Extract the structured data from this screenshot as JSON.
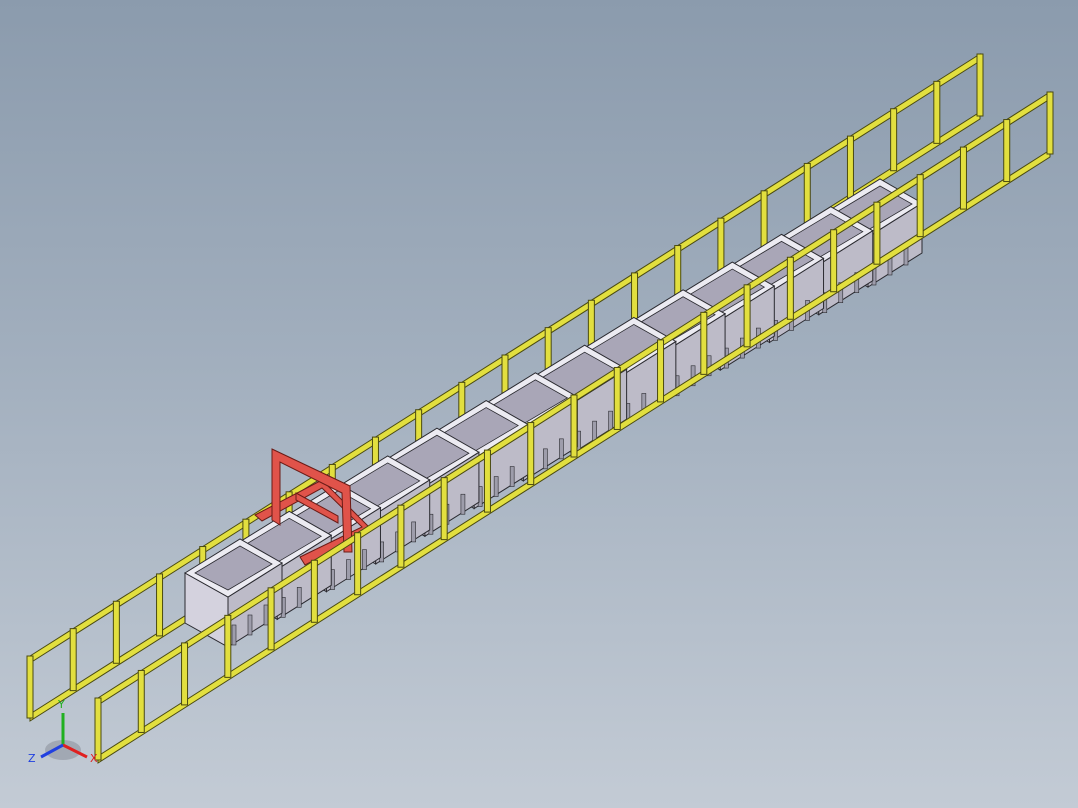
{
  "view": {
    "background_top": "#8b9bad",
    "background_bottom": "#c3cbd5"
  },
  "model": {
    "rail_color": "#e2df3f",
    "rail_edge": "#4a4a10",
    "tank_color": "#d4d2de",
    "tank_inner": "#a9a6b7",
    "tank_edge": "#2a2a30",
    "gantry_color": "#e0534a",
    "gantry_edge": "#6a1b16",
    "tank_count": 14
  },
  "triad": {
    "x_label": "X",
    "y_label": "Y",
    "z_label": "Z",
    "x_color": "#e02020",
    "y_color": "#20b020",
    "z_color": "#2040e0"
  }
}
